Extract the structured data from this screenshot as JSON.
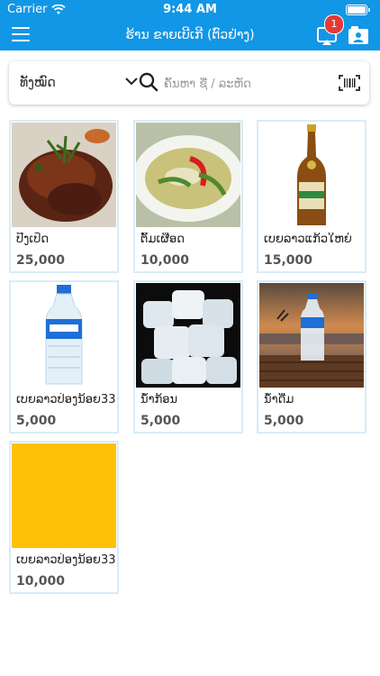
{
  "status": {
    "carrier": "Carrier",
    "time": "9:44 AM"
  },
  "nav": {
    "title": "ຮ້ານ ຂາຍເບີເກີ (ຕົວຢ່າງ)",
    "cart_count": "1"
  },
  "filter": {
    "category": "ທັງໝົດ",
    "search_placeholder": "ຄົ້ນຫາ ຊື່ / ລະຫັດ"
  },
  "products": [
    {
      "name": "ປີ້ງເປັດ",
      "price": "25,000",
      "image": "grilled-duck"
    },
    {
      "name": "ຕົ້ມເຜືອດ",
      "price": "10,000",
      "image": "green-curry"
    },
    {
      "name": "ເບຍລາວແກ້ວໃຫຍ່",
      "price": "15,000",
      "image": "beer-bottle"
    },
    {
      "name": "ເບຍລາວປ່ອງນ້ອຍ330",
      "price": "5,000",
      "image": "water-bottle"
    },
    {
      "name": "ນ້ຳກ້ອນ",
      "price": "5,000",
      "image": "ice"
    },
    {
      "name": "ນ້ຳດື່ມ",
      "price": "5,000",
      "image": "water-on-table"
    },
    {
      "name": "ເບຍລາວປ່ອງນ້ອຍ330",
      "price": "10,000",
      "image": "yellow-placeholder"
    }
  ],
  "colors": {
    "primary": "#1296e6",
    "badge": "#e53935",
    "card_border": "#d8ecf7",
    "placeholder_yellow": "#ffc107"
  }
}
